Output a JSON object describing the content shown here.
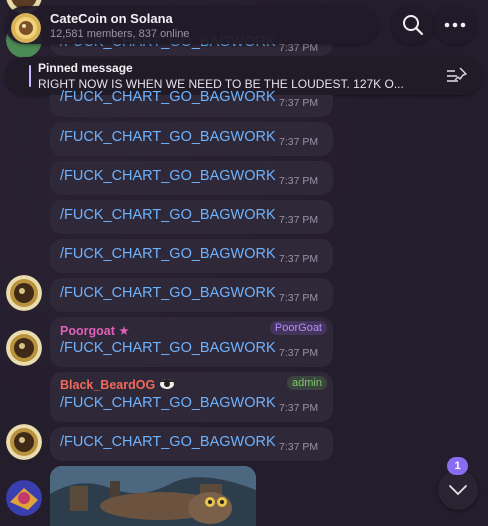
{
  "header": {
    "title": "CateCoin on Solana",
    "subtitle": "12,581 members, 837 online",
    "search_icon": "search-icon",
    "menu_icon": "more-icon"
  },
  "pinned": {
    "label": "Pinned message",
    "text": "RIGHT NOW IS WHEN WE NEED TO BE THE LOUDEST. 127K O..."
  },
  "messages": [
    {
      "text": "/FUCK_CHART_GO_BAGWORK",
      "time": "7:37 PM"
    },
    {
      "text": "/FUCK_CHART_GO_BAGWORK",
      "time": "7:37 PM"
    },
    {
      "text": "/FUCK_CHART_GO_BAGWORK",
      "time": "7:37 PM"
    },
    {
      "text": "/FUCK_CHART_GO_BAGWORK",
      "time": "7:37 PM"
    },
    {
      "text": "/FUCK_CHART_GO_BAGWORK",
      "time": "7:37 PM"
    },
    {
      "text": "/FUCK_CHART_GO_BAGWORK",
      "time": "7:37 PM"
    },
    {
      "text": "/FUCK_CHART_GO_BAGWORK",
      "time": "7:37 PM",
      "sender": "Poorgoat",
      "sender_star": "★",
      "badge": "PoorGoat"
    },
    {
      "text": "/FUCK_CHART_GO_BAGWORK",
      "time": "7:37 PM",
      "sender": "Black_BeardOG",
      "badge": "admin"
    },
    {
      "text": "/FUCK_CHART_GO_BAGWORK",
      "time": "7:37 PM"
    }
  ],
  "unread_count": "1",
  "colors": {
    "background": "#241d2c",
    "bubble": "#2f2838",
    "command_link": "#6fb3ff",
    "poorgoat_name": "#e060b8",
    "blackbeard_name": "#f06a5a",
    "admin_badge": "#7fc86a",
    "accent": "#8a6cf0"
  }
}
